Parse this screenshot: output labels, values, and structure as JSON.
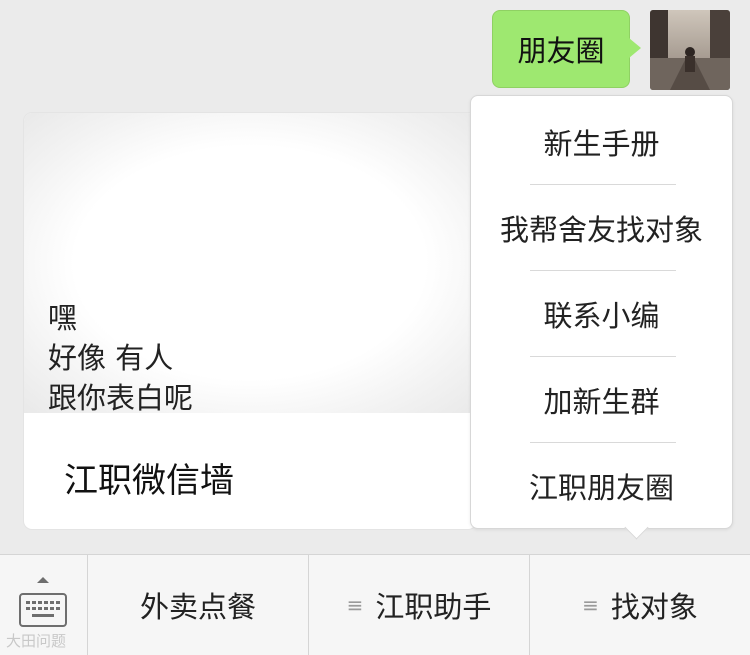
{
  "sent_message": {
    "text": "朋友圈"
  },
  "card": {
    "lines": [
      "嘿",
      "好像 有人",
      "跟你表白呢"
    ],
    "title": "江职微信墙"
  },
  "popup_menu": {
    "items": [
      "新生手册",
      "我帮舍友找对象",
      "联系小编",
      "加新生群",
      "江职朋友圈"
    ]
  },
  "menu_bar": {
    "keyboard_icon": "keyboard-icon",
    "tabs": [
      {
        "label": "外卖点餐",
        "icon": ""
      },
      {
        "label": "江职助手",
        "icon": "≡"
      },
      {
        "label": "找对象",
        "icon": "≡"
      }
    ]
  },
  "watermark": {
    "text": "大田问题"
  },
  "colors": {
    "bubble_green": "#9ee870",
    "background": "#ebebeb",
    "menubar": "#f6f6f6"
  }
}
